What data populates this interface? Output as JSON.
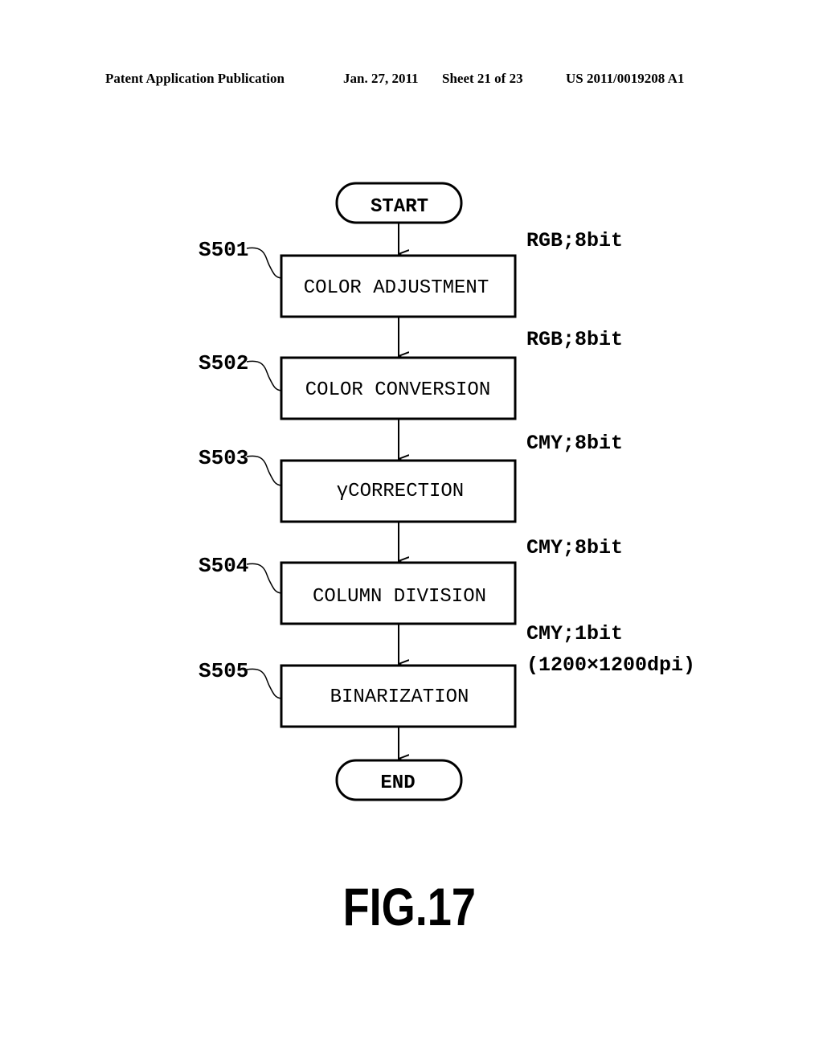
{
  "header": {
    "publication": "Patent Application Publication",
    "date": "Jan. 27, 2011",
    "sheet": "Sheet 21 of 23",
    "number": "US 2011/0019208 A1"
  },
  "flowchart": {
    "start_label": "START",
    "end_label": "END",
    "steps": [
      {
        "id": "S501",
        "label": "COLOR ADJUSTMENT",
        "input_format": "RGB;8bit"
      },
      {
        "id": "S502",
        "label": "COLOR CONVERSION",
        "input_format": "RGB;8bit"
      },
      {
        "id": "S503",
        "label": "γCORRECTION",
        "input_format": "CMY;8bit"
      },
      {
        "id": "S504",
        "label": "COLUMN DIVISION",
        "input_format": "CMY;8bit"
      },
      {
        "id": "S505",
        "label": "BINARIZATION",
        "input_format": "CMY;1bit",
        "input_format_detail": "(1200×1200dpi)"
      }
    ]
  },
  "figure_label": "FIG.17"
}
